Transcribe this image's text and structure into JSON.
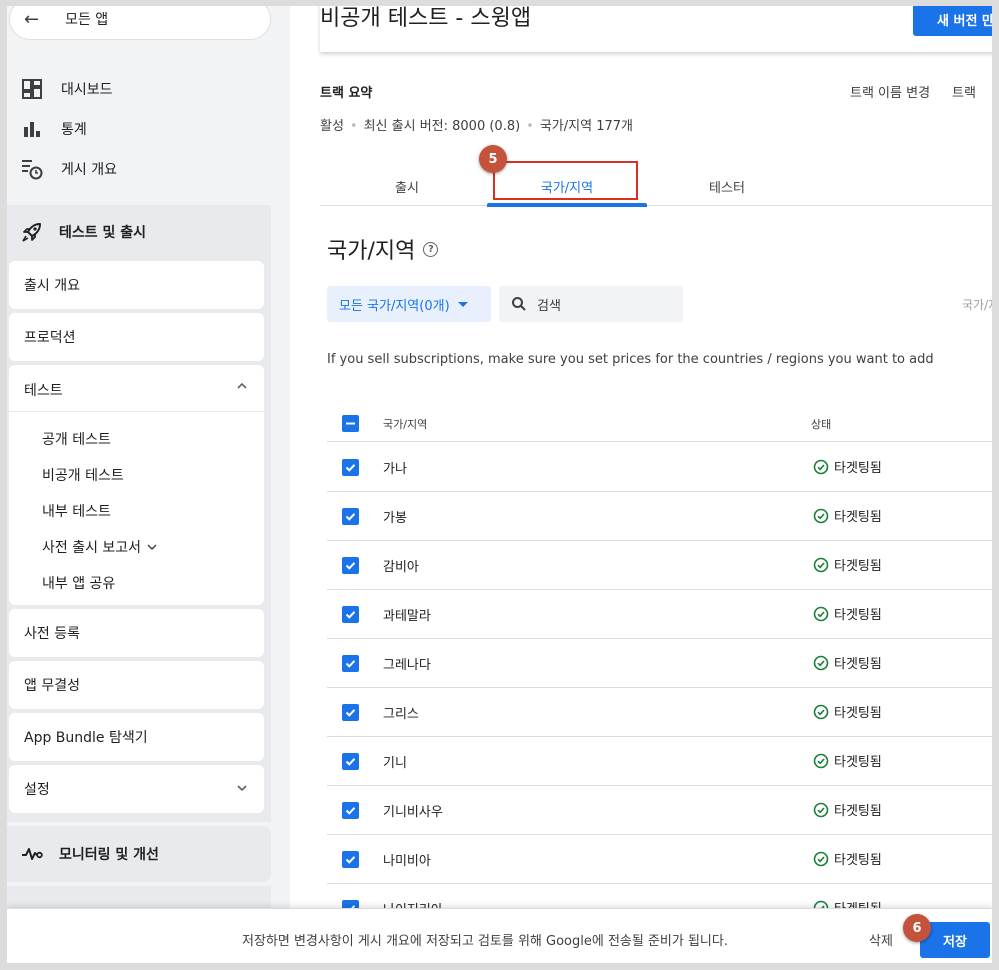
{
  "sidebar": {
    "back_label": "모든 앱",
    "items": [
      {
        "label": "대시보드",
        "icon": "dashboard-icon"
      },
      {
        "label": "통계",
        "icon": "bar-chart-icon"
      },
      {
        "label": "게시 개요",
        "icon": "publishing-overview-icon"
      }
    ],
    "test_release": {
      "title": "테스트 및 출시",
      "icon": "rocket-icon",
      "cards": [
        {
          "label": "출시 개요"
        },
        {
          "label": "프로덕션"
        },
        {
          "label": "테스트"
        },
        {
          "label": "사전 등록"
        },
        {
          "label": "앱 무결성"
        },
        {
          "label": "App Bundle 탐색기"
        },
        {
          "label": "설정"
        }
      ],
      "testing_sub": [
        {
          "label": "공개 테스트"
        },
        {
          "label": "비공개 테스트"
        },
        {
          "label": "내부 테스트"
        },
        {
          "label": "사전 출시 보고서"
        },
        {
          "label": "내부 앱 공유"
        }
      ]
    },
    "monitor": {
      "title": "모니터링 및 개선",
      "icon": "vitals-icon"
    }
  },
  "header": {
    "title": "비공개 테스트 - 스윙앱",
    "new_release_btn": "새 버전 만"
  },
  "track": {
    "summary_label": "트랙 요약",
    "rename_label": "트랙 이름 변경",
    "more_label": "트랙 ",
    "status": "활성",
    "latest_version": "최신 출시 버전: 8000 (0.8)",
    "countries": "국가/지역 177개"
  },
  "tabs": [
    {
      "label": "출시"
    },
    {
      "label": "국가/지역"
    },
    {
      "label": "테스터"
    }
  ],
  "badges": {
    "step5": "5",
    "step6": "6"
  },
  "section": {
    "title": "국가/지역",
    "help": "?",
    "filter_label": "모든 국가/지역(0개)",
    "search_placeholder": "검색",
    "right_hint": "국가/지",
    "notice": "If you sell subscriptions, make sure you set prices for the countries / regions you want to add"
  },
  "table": {
    "col_country": "국가/지역",
    "col_status": "상태",
    "rows": [
      {
        "name": "가나",
        "status": "타겟팅됨"
      },
      {
        "name": "가봉",
        "status": "타겟팅됨"
      },
      {
        "name": "감비아",
        "status": "타겟팅됨"
      },
      {
        "name": "과테말라",
        "status": "타겟팅됨"
      },
      {
        "name": "그레나다",
        "status": "타겟팅됨"
      },
      {
        "name": "그리스",
        "status": "타겟팅됨"
      },
      {
        "name": "기니",
        "status": "타겟팅됨"
      },
      {
        "name": "기니비사우",
        "status": "타겟팅됨"
      },
      {
        "name": "나미비아",
        "status": "타겟팅됨"
      },
      {
        "name": "나이지리아",
        "status": "타겟팅됨"
      }
    ]
  },
  "save_bar": {
    "message": "저장하면 변경사항이 게시 개요에 저장되고 검토를 위해 Google에 전송될 준비가 됩니다.",
    "discard_label": "삭제",
    "save_label": "저장"
  },
  "colors": {
    "accent": "#1a73e8",
    "badge": "#c5523a",
    "highlight": "#d93025",
    "success": "#188038"
  }
}
